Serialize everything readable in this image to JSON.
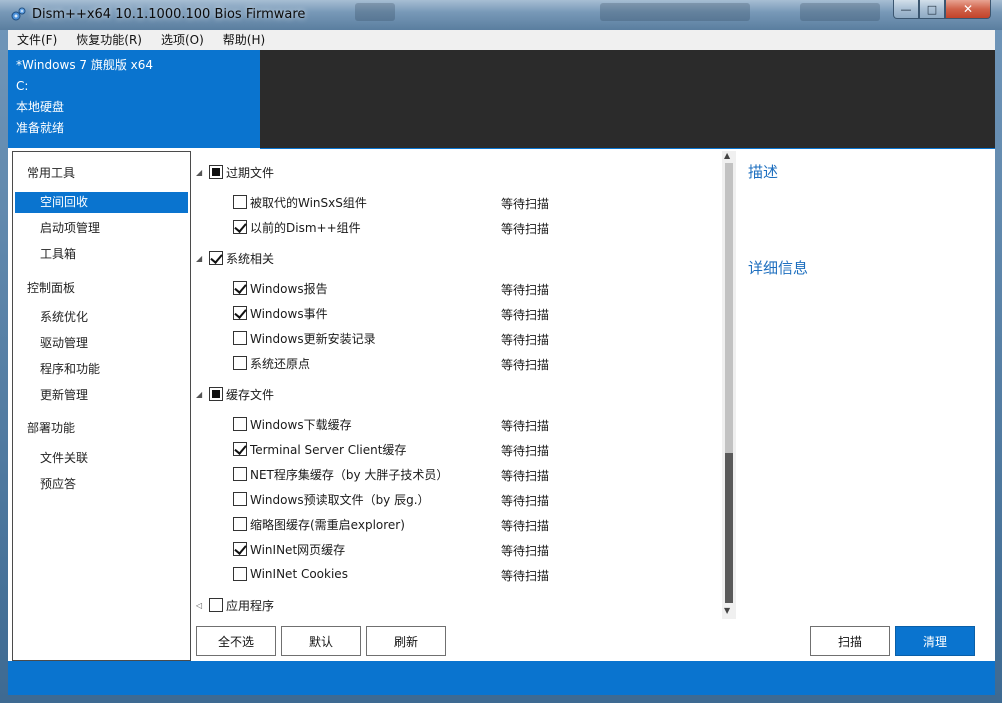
{
  "window": {
    "title": "Dism++x64 10.1.1000.100 Bios Firmware",
    "min_glyph": "—",
    "max_glyph": "□",
    "close_glyph": "✕"
  },
  "menu": [
    "文件(F)",
    "恢复功能(R)",
    "选项(O)",
    "帮助(H)"
  ],
  "info": {
    "os": "*Windows 7 旗舰版 x64",
    "drive": "C:",
    "disk_type": "本地硬盘",
    "state": "准备就绪"
  },
  "nav": {
    "groups": [
      {
        "label": "常用工具",
        "items": [
          "空间回收",
          "启动项管理",
          "工具箱"
        ]
      },
      {
        "label": "控制面板",
        "items": [
          "系统优化",
          "驱动管理",
          "程序和功能",
          "更新管理"
        ]
      },
      {
        "label": "部署功能",
        "items": [
          "文件关联",
          "预应答"
        ]
      }
    ],
    "selected": "空间回收"
  },
  "categories": [
    {
      "label": "过期文件",
      "state": "partial",
      "items": [
        {
          "label": "被取代的WinSxS组件",
          "checked": false,
          "status": "等待扫描"
        },
        {
          "label": "以前的Dism++组件",
          "checked": true,
          "status": "等待扫描"
        }
      ]
    },
    {
      "label": "系统相关",
      "state": "checked",
      "items": [
        {
          "label": "Windows报告",
          "checked": true,
          "status": "等待扫描"
        },
        {
          "label": "Windows事件",
          "checked": true,
          "status": "等待扫描"
        },
        {
          "label": "Windows更新安装记录",
          "checked": false,
          "status": "等待扫描"
        },
        {
          "label": "系统还原点",
          "checked": false,
          "status": "等待扫描"
        }
      ]
    },
    {
      "label": "缓存文件",
      "state": "partial",
      "items": [
        {
          "label": "Windows下载缓存",
          "checked": false,
          "status": "等待扫描"
        },
        {
          "label": "Terminal Server Client缓存",
          "checked": true,
          "status": "等待扫描"
        },
        {
          "label": "NET程序集缓存（by 大胖子技术员）",
          "checked": false,
          "status": "等待扫描"
        },
        {
          "label": "Windows预读取文件（by 辰g.）",
          "checked": false,
          "status": "等待扫描"
        },
        {
          "label": "缩略图缓存(需重启explorer)",
          "checked": false,
          "status": "等待扫描"
        },
        {
          "label": "WinINet网页缓存",
          "checked": true,
          "status": "等待扫描"
        },
        {
          "label": "WinINet Cookies",
          "checked": false,
          "status": "等待扫描"
        }
      ]
    },
    {
      "label": "应用程序",
      "state": "unchecked",
      "items": []
    }
  ],
  "details": {
    "description_title": "描述",
    "detail_title": "详细信息"
  },
  "buttons": {
    "deselect_all": "全不选",
    "default": "默认",
    "refresh": "刷新",
    "scan": "扫描",
    "clean": "清理"
  },
  "colors": {
    "accent": "#0a74cf",
    "header_dark": "#2b2b2b",
    "heading_blue": "#1e6fbf"
  }
}
